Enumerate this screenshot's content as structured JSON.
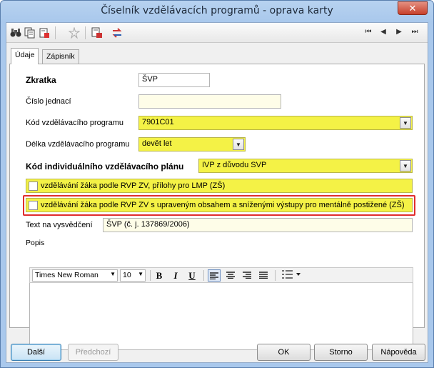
{
  "window": {
    "title": "Číselník vzdělávacích programů - oprava karty",
    "close_label": "✕"
  },
  "toolbar": {
    "icons": [
      "binoculars-search-icon",
      "copy-icon",
      "new-record-icon",
      "delete-icon",
      "export-icon",
      "refresh-icon"
    ],
    "nav": {
      "first": "⏮",
      "prev": "◀",
      "next": "▶",
      "last": "⏭"
    }
  },
  "tabs": [
    {
      "label": "Údaje",
      "active": true
    },
    {
      "label": "Zápisník",
      "active": false
    }
  ],
  "form": {
    "zkratka": {
      "label": "Zkratka",
      "value": "ŠVP"
    },
    "cislo_jednaci": {
      "label": "Číslo jednací",
      "value": ""
    },
    "kod_programu": {
      "label": "Kód vzdělávacího programu",
      "value": "7901C01"
    },
    "delka_programu": {
      "label": "Délka vzdělávacího programu",
      "value": "devět let"
    },
    "kod_ivp": {
      "label": "Kód individuálního vzdělávacího plánu",
      "value": "IVP z důvodu SVP"
    },
    "check1": {
      "label": "vzdělávání žáka podle RVP ZV, přílohy pro LMP (ZŠ)",
      "checked": false
    },
    "check2": {
      "label": "vzdělávání žáka podle RVP ZV s upraveným obsahem a sníženými výstupy pro mentálně postižené (ZŠ)",
      "checked": false
    },
    "text_vysvedceni": {
      "label": "Text na vysvědčení",
      "value": "ŠVP (č. j. 137869/2006)"
    },
    "popis": {
      "label": "Popis",
      "font": "Times New Roman",
      "size": "10",
      "bold": "B",
      "italic": "I",
      "underline": "U"
    }
  },
  "buttons": {
    "dalsi": "Další",
    "predchozi": "Předchozí",
    "ok": "OK",
    "storno": "Storno",
    "napoveda": "Nápověda"
  },
  "colors": {
    "highlight_yellow": "#f4f246",
    "field_cream": "#fefde8",
    "callout_red": "#e02c2c"
  }
}
